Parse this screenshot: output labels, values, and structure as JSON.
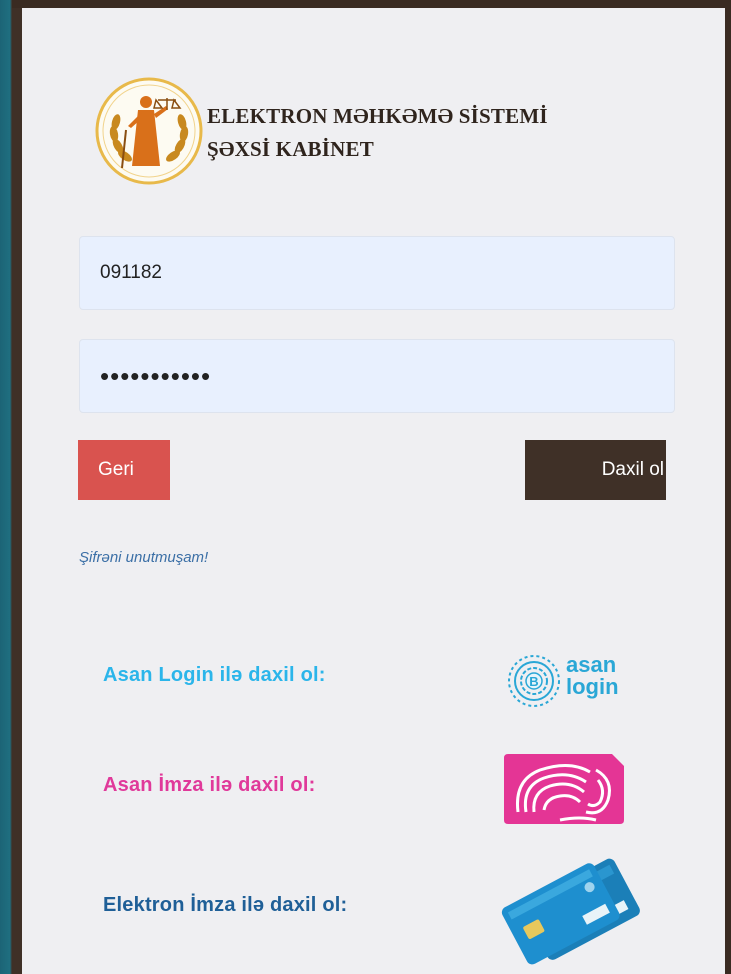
{
  "header": {
    "title_line1": "ELEKTRON MƏHKƏMƏ SİSTEMİ",
    "title_line2": "ŞƏXSİ KABİNET"
  },
  "form": {
    "username_value": "091182",
    "password_value": "•••••••••••"
  },
  "buttons": {
    "back_label": "Geri",
    "login_label": "Daxil ol"
  },
  "links": {
    "forgot_password": "Şifrəni unutmuşam!"
  },
  "login_options": {
    "asan_login_label": "Asan Login ilə daxil ol:",
    "asan_imza_label": "Asan İmza ilə daxil ol:",
    "elektron_imza_label": "Elektron İmza ilə daxil ol:",
    "asan_logo_line1": "asan",
    "asan_logo_line2": "login"
  },
  "colors": {
    "brown": "#3f3027",
    "red": "#d9534f",
    "asan_blue": "#2bb5ea",
    "imza_pink": "#e0399a",
    "elektron_blue": "#1f5f97"
  }
}
